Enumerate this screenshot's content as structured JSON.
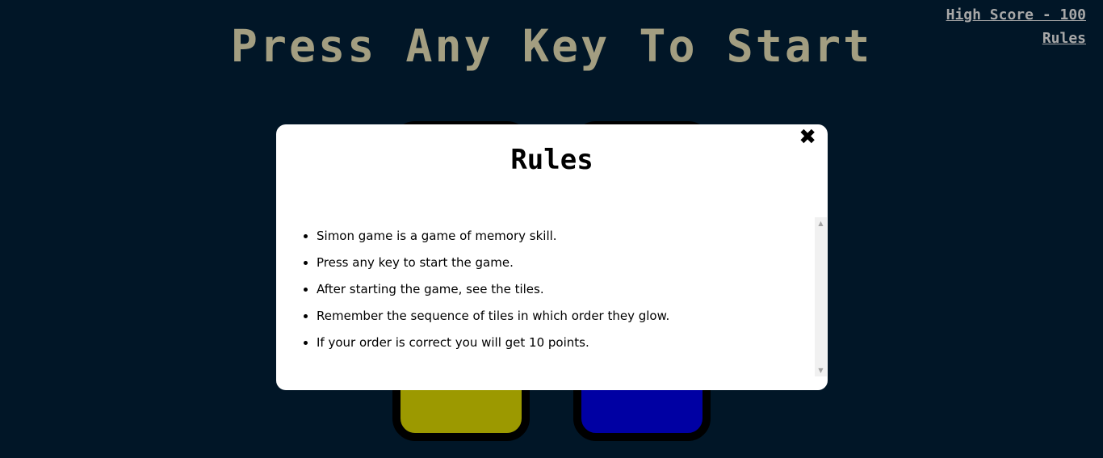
{
  "header": {
    "title": "Press Any Key To Start",
    "high_score": "High Score - 100",
    "rules_link": "Rules"
  },
  "colors": {
    "background": "#011627",
    "title": "#a39e81",
    "link": "#a8a8a8",
    "tile_green": "#000000",
    "tile_red": "#000000",
    "tile_yellow": "#9c9900",
    "tile_blue": "#0000a3",
    "modal_background": "#ffffff"
  },
  "modal": {
    "close_icon": "✖",
    "title": "Rules",
    "rules": [
      "Simon game is a game of memory skill.",
      "Press any key to start the game.",
      "After starting the game, see the tiles.",
      "Remember the sequence of tiles in which order they glow.",
      "If your order is correct you will get 10 points."
    ],
    "scroll_up_icon": "▲",
    "scroll_down_icon": "▼"
  }
}
